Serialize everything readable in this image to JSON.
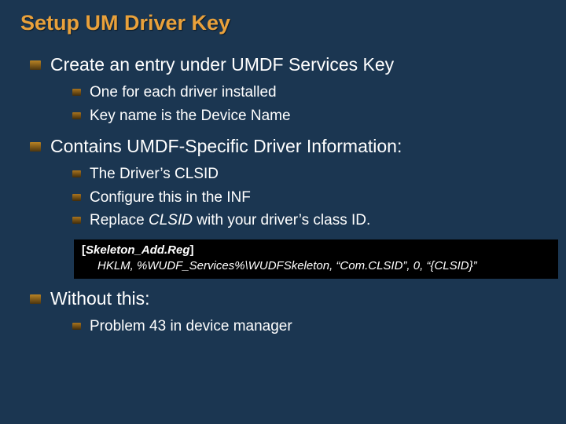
{
  "title": "Setup UM Driver Key",
  "b1": {
    "text": "Create an entry under UMDF Services Key",
    "s1": "One for each driver installed",
    "s2": "Key name is the Device Name"
  },
  "b2": {
    "text": "Contains UMDF-Specific Driver Information:",
    "s1": "The Driver’s CLSID",
    "s2": "Configure this in the INF",
    "s3_a": "Replace ",
    "s3_i": "CLSID",
    "s3_b": " with your driver’s class ID."
  },
  "code": {
    "head_open": "[",
    "head_text": "Skeleton_Add.Reg",
    "head_close": "]",
    "l1_a": "HKLM, ",
    "l1_b": "%WUDF_Services%",
    "l1_c": "\\WUDFSkeleton, “Com.CLSID”, 0, “{",
    "l1_d": "CLSID",
    "l1_e": "}”"
  },
  "b3": {
    "text": "Without this:",
    "s1": "Problem 43 in device manager"
  }
}
